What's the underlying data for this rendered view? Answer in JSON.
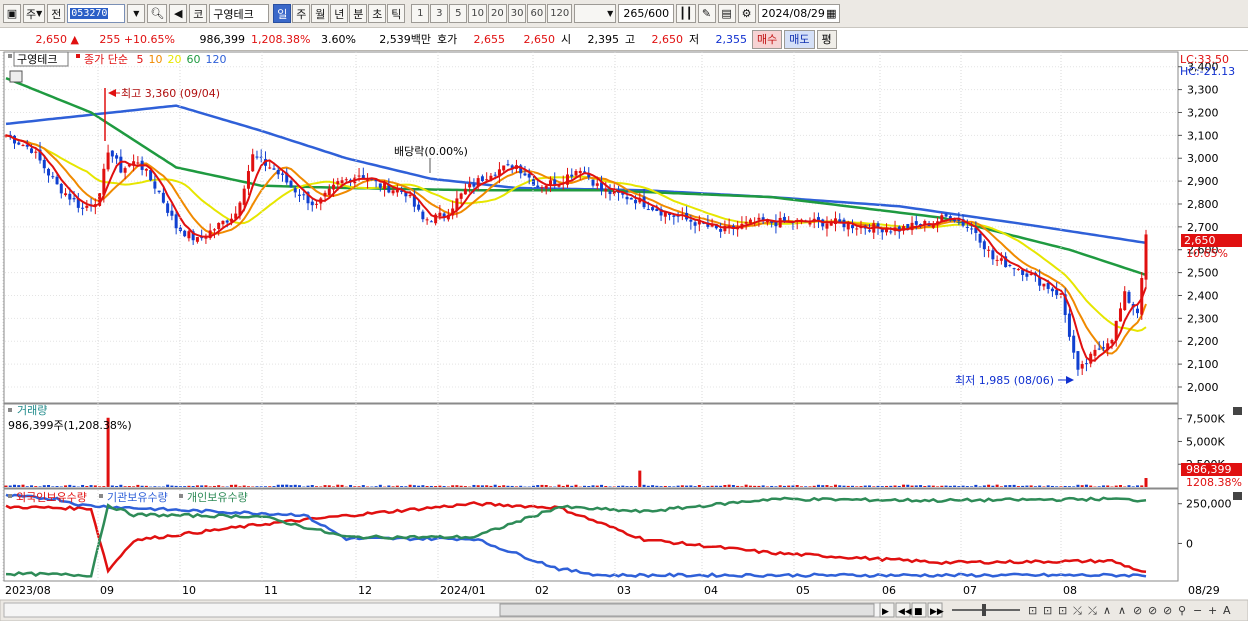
{
  "toolbar": {
    "period_day": "주",
    "prev_label": "전",
    "stock_code": "053270",
    "market_label": "코",
    "stock_name": "구영테크",
    "periods": [
      {
        "label": "일",
        "selected": true
      },
      {
        "label": "주",
        "selected": false
      },
      {
        "label": "월",
        "selected": false
      },
      {
        "label": "년",
        "selected": false
      },
      {
        "label": "분",
        "selected": false
      },
      {
        "label": "초",
        "selected": false
      },
      {
        "label": "틱",
        "selected": false
      }
    ],
    "intervals": [
      "1",
      "3",
      "5",
      "10",
      "20",
      "30",
      "60",
      "120"
    ],
    "count_display": "265/600",
    "date": "2024/08/29"
  },
  "quote": {
    "price": "2,650",
    "change": "255",
    "change_pct": "+10.65%",
    "volume": "986,399",
    "volume_ratio": "1,208.38%",
    "turnover": "3.60%",
    "amount": "2,539백만",
    "ask_label": "호가",
    "ask": "2,655",
    "bid": "2,650",
    "open_label": "시",
    "open": "2,395",
    "high_label": "고",
    "high": "2,650",
    "low_label": "저",
    "low": "2,355",
    "buy_label": "매수",
    "sell_label": "매도",
    "eval_label": "평"
  },
  "price_panel": {
    "stock_label": "구영테크",
    "ma_label": "종가 단순",
    "ma_periods": [
      {
        "label": "5",
        "color": "#e01010"
      },
      {
        "label": "10",
        "color": "#f08a00"
      },
      {
        "label": "20",
        "color": "#e6e600"
      },
      {
        "label": "60",
        "color": "#1f9a40"
      },
      {
        "label": "120",
        "color": "#2f60d8"
      }
    ],
    "lc_label": "LC:33.50",
    "hc_label": "HC:-21.13",
    "high_annotation": "최고 3,360 (09/04)",
    "low_annotation": "최저 1,985 (08/06)",
    "dividend_annotation": "배당락(0.00%)",
    "current_price_tag": "2,650",
    "current_pct_tag": "10.65%"
  },
  "volume_panel": {
    "title": "거래량",
    "info": "986,399주(1,208.38%)",
    "current_tag": "986,399",
    "current_pct_tag": "1208.38%",
    "yticks": [
      "7,500K",
      "5,000K",
      "2,500K"
    ]
  },
  "holding_panel": {
    "titles": [
      {
        "label": "외국인보유수량",
        "color": "#e01010"
      },
      {
        "label": "기관보유수량",
        "color": "#2f60d8"
      },
      {
        "label": "개인보유수량",
        "color": "#2e8b57"
      }
    ],
    "yticks": [
      "250,000",
      "0"
    ]
  },
  "x_axis_labels": [
    "2023/08",
    "09",
    "10",
    "11",
    "12",
    "2024/01",
    "02",
    "03",
    "04",
    "05",
    "06",
    "07",
    "08",
    "08/29"
  ],
  "chart_data": {
    "type": "line",
    "title": "구영테크",
    "price_yticks": [
      3400,
      3300,
      3200,
      3100,
      3000,
      2900,
      2800,
      2700,
      2600,
      2500,
      2400,
      2300,
      2200,
      2100,
      2000
    ],
    "price_range": [
      1930,
      3460
    ],
    "series": [
      {
        "name": "5",
        "type": "ma",
        "color": "#e01010"
      },
      {
        "name": "10",
        "type": "ma",
        "color": "#f08a00"
      },
      {
        "name": "20",
        "type": "ma",
        "color": "#e6e600"
      },
      {
        "name": "60",
        "type": "ma",
        "color": "#1f9a40"
      },
      {
        "name": "120",
        "type": "ma",
        "color": "#2f60d8"
      }
    ],
    "price_keypoints": [
      [
        0,
        3100
      ],
      [
        6,
        3040
      ],
      [
        12,
        2880
      ],
      [
        18,
        2780
      ],
      [
        22,
        2830
      ],
      [
        24,
        3040
      ],
      [
        27,
        2950
      ],
      [
        31,
        2990
      ],
      [
        36,
        2850
      ],
      [
        40,
        2700
      ],
      [
        45,
        2640
      ],
      [
        48,
        2680
      ],
      [
        54,
        2760
      ],
      [
        58,
        3010
      ],
      [
        63,
        2950
      ],
      [
        68,
        2860
      ],
      [
        73,
        2790
      ],
      [
        78,
        2890
      ],
      [
        83,
        2930
      ],
      [
        88,
        2880
      ],
      [
        94,
        2850
      ],
      [
        98,
        2730
      ],
      [
        103,
        2750
      ],
      [
        108,
        2860
      ],
      [
        114,
        2940
      ],
      [
        120,
        2970
      ],
      [
        125,
        2880
      ],
      [
        130,
        2900
      ],
      [
        135,
        2960
      ],
      [
        140,
        2860
      ],
      [
        148,
        2820
      ],
      [
        155,
        2760
      ],
      [
        162,
        2720
      ],
      [
        168,
        2680
      ],
      [
        176,
        2720
      ],
      [
        185,
        2720
      ],
      [
        194,
        2720
      ],
      [
        202,
        2700
      ],
      [
        210,
        2690
      ],
      [
        218,
        2720
      ],
      [
        222,
        2750
      ],
      [
        228,
        2680
      ],
      [
        232,
        2560
      ],
      [
        238,
        2520
      ],
      [
        244,
        2450
      ],
      [
        248,
        2400
      ],
      [
        252,
        2060
      ],
      [
        256,
        2150
      ],
      [
        260,
        2220
      ],
      [
        263,
        2400
      ],
      [
        266,
        2330
      ],
      [
        268,
        2650
      ]
    ],
    "ma60_keypoints": [
      [
        0,
        3350
      ],
      [
        20,
        3200
      ],
      [
        40,
        2960
      ],
      [
        60,
        2880
      ],
      [
        80,
        2870
      ],
      [
        110,
        2860
      ],
      [
        140,
        2860
      ],
      [
        180,
        2830
      ],
      [
        220,
        2740
      ],
      [
        250,
        2600
      ],
      [
        268,
        2490
      ]
    ],
    "ma120_keypoints": [
      [
        0,
        3150
      ],
      [
        20,
        3190
      ],
      [
        40,
        3230
      ],
      [
        60,
        3120
      ],
      [
        80,
        3000
      ],
      [
        100,
        2910
      ],
      [
        120,
        2870
      ],
      [
        150,
        2860
      ],
      [
        180,
        2830
      ],
      [
        210,
        2790
      ],
      [
        240,
        2710
      ],
      [
        268,
        2630
      ]
    ],
    "volume_spikes": [
      [
        24,
        7600
      ],
      [
        149,
        1800
      ],
      [
        268,
        986
      ]
    ],
    "foreign_keypoints": [
      [
        0,
        230
      ],
      [
        20,
        220
      ],
      [
        24,
        -170
      ],
      [
        30,
        20
      ],
      [
        60,
        120
      ],
      [
        80,
        175
      ],
      [
        110,
        250
      ],
      [
        130,
        225
      ],
      [
        150,
        25
      ],
      [
        180,
        -60
      ],
      [
        220,
        -120
      ],
      [
        260,
        -110
      ],
      [
        268,
        -185
      ]
    ],
    "institution_keypoints": [
      [
        0,
        300
      ],
      [
        12,
        280
      ],
      [
        18,
        240
      ],
      [
        40,
        210
      ],
      [
        70,
        180
      ],
      [
        80,
        30
      ],
      [
        110,
        30
      ],
      [
        130,
        -160
      ],
      [
        140,
        -200
      ],
      [
        268,
        -200
      ]
    ],
    "individual_keypoints": [
      [
        0,
        -190
      ],
      [
        20,
        -200
      ],
      [
        24,
        240
      ],
      [
        30,
        180
      ],
      [
        60,
        170
      ],
      [
        80,
        40
      ],
      [
        110,
        40
      ],
      [
        130,
        230
      ],
      [
        150,
        200
      ],
      [
        180,
        280
      ],
      [
        220,
        270
      ],
      [
        260,
        280
      ],
      [
        268,
        270
      ]
    ]
  }
}
